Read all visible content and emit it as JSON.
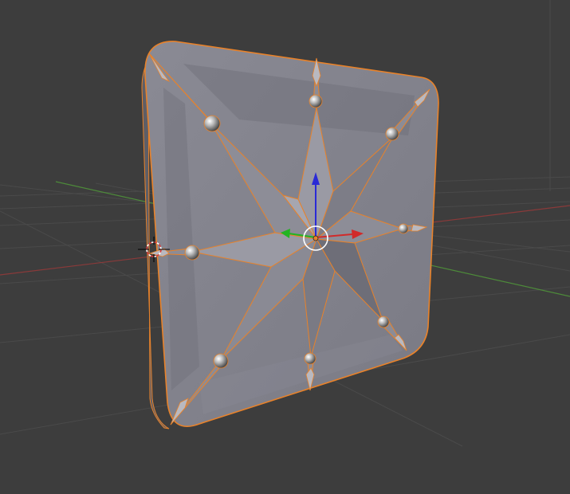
{
  "viewport": {
    "mode": "3D Viewport",
    "background": "#3d3d3d",
    "grid_color": "#4a4a4a",
    "x_axis_color": "#8a3a3a",
    "y_axis_color": "#4d8a3a"
  },
  "object": {
    "name": "square-panel-with-star",
    "face_color": "#7c7c86",
    "outline_color": "#e8822a",
    "selected": true
  },
  "gizmo": {
    "x_color": "#d12a2a",
    "y_color": "#22b422",
    "z_color": "#2a2ad6",
    "origin_color": "#e8822a"
  },
  "cursor_3d": {
    "icon": "3d-cursor-icon"
  }
}
